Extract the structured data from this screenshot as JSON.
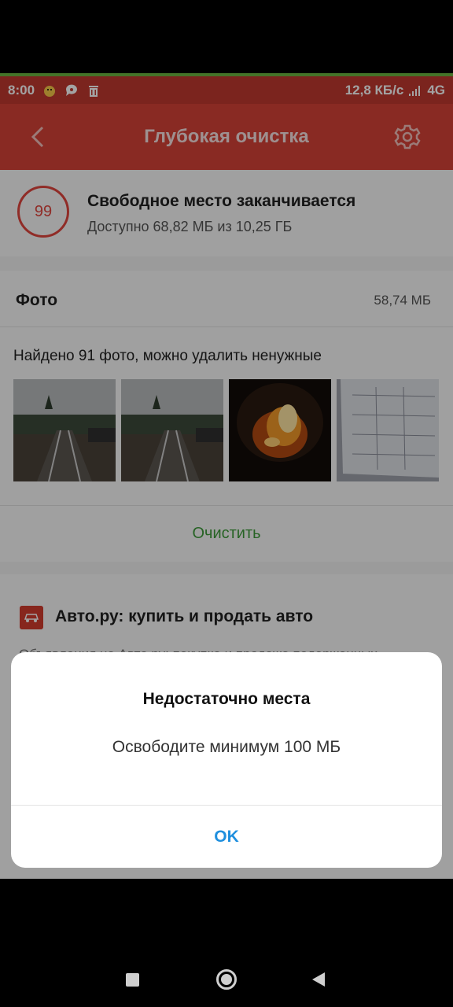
{
  "status_bar": {
    "time": "8:00",
    "network_speed": "12,8 КБ/с",
    "network_type": "4G",
    "icons": [
      "chick-icon",
      "chat-bubble-icon",
      "trash-icon",
      "signal-icon"
    ]
  },
  "toolbar": {
    "title": "Глубокая очистка",
    "back_icon": "chevron-left-icon",
    "settings_icon": "gear-icon"
  },
  "storage": {
    "score": "99",
    "title": "Свободное место заканчивается",
    "subtitle": "Доступно 68,82 МБ из 10,25 ГБ"
  },
  "photos": {
    "title": "Фото",
    "size": "58,74 МБ",
    "found_text": "Найдено 91 фото, можно удалить ненужные",
    "clean_label": "Очистить"
  },
  "ad": {
    "title": "Авто.ру: купить и продать авто",
    "description": "Объявления на Авто.ру: покупка и продажа подержанных"
  },
  "dialog": {
    "title": "Недостаточно места",
    "message": "Освободите минимум 100 МБ",
    "ok_label": "OK"
  },
  "colors": {
    "status_bar": "#c0392f",
    "toolbar": "#d64237",
    "accent_red": "#e1463e",
    "clean_green": "#3e9c3a",
    "ok_blue": "#1f8fde"
  }
}
